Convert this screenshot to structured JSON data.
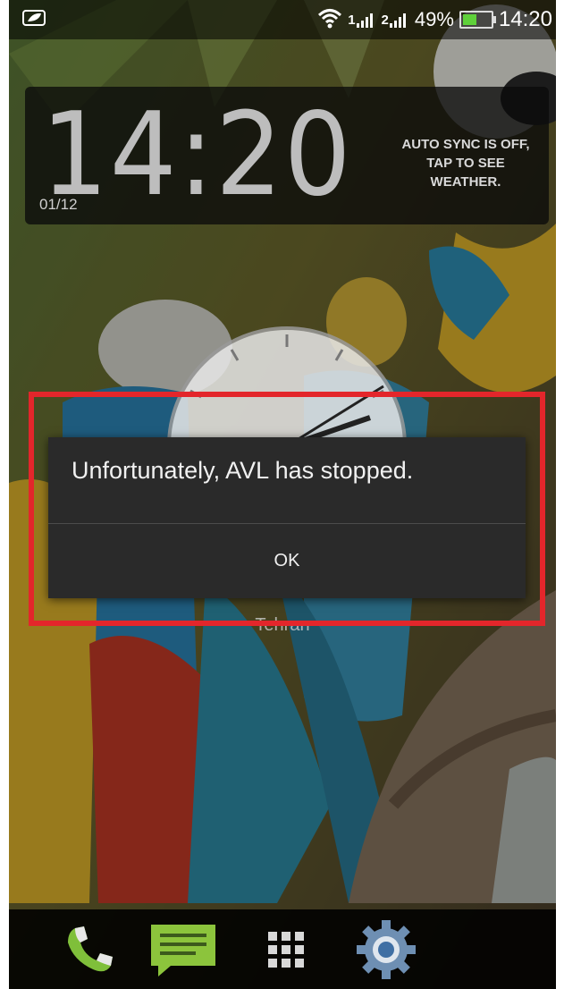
{
  "status_bar": {
    "sim1_label": "1",
    "sim2_label": "2",
    "battery_percent": "49%",
    "time": "14:20",
    "battery_level": 0.49,
    "icons": [
      "leaf-icon",
      "wifi-icon",
      "signal-icon",
      "battery-icon"
    ]
  },
  "clock_widget": {
    "time": "14:20",
    "date": "01/12",
    "sync_message_line1": "AUTO SYNC IS OFF,",
    "sync_message_line2": "TAP TO SEE",
    "sync_message_line3": "WEATHER."
  },
  "city_label": "Tehran",
  "dialog": {
    "message": "Unfortunately, AVL has stopped.",
    "ok_label": "OK"
  },
  "dock": {
    "items": [
      "phone-icon",
      "messages-icon",
      "apps-grid-icon",
      "settings-icon"
    ]
  },
  "colors": {
    "highlight": "#e3262b",
    "dialog_bg": "#2a2a2a",
    "battery": "#5fd13a"
  }
}
